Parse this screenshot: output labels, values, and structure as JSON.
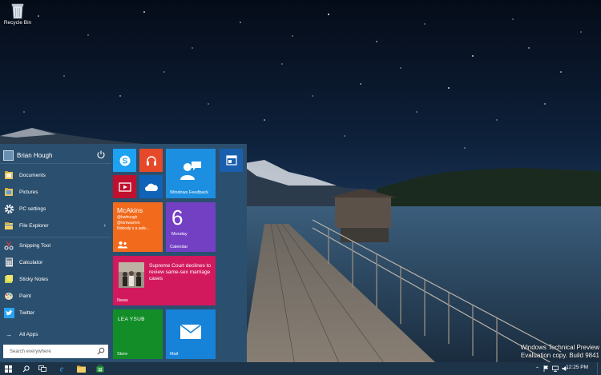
{
  "desktop": {
    "recycle_bin_label": "Recycle Bin"
  },
  "start_menu": {
    "user_name": "Brian Hough",
    "items": [
      {
        "label": "Documents",
        "icon": "documents-folder-icon"
      },
      {
        "label": "Pictures",
        "icon": "pictures-folder-icon"
      },
      {
        "label": "PC settings",
        "icon": "gear-icon"
      },
      {
        "label": "File Explorer",
        "icon": "file-explorer-icon",
        "has_submenu": true
      },
      {
        "label": "Snipping Tool",
        "icon": "scissors-icon"
      },
      {
        "label": "Calculator",
        "icon": "calculator-icon"
      },
      {
        "label": "Sticky Notes",
        "icon": "sticky-notes-icon"
      },
      {
        "label": "Paint",
        "icon": "paint-icon"
      },
      {
        "label": "Twitter",
        "icon": "twitter-bird-icon"
      }
    ],
    "all_apps_label": "All Apps",
    "search_placeholder": "Search everywhere"
  },
  "tiles": {
    "feedback_label": "Windows Feedback",
    "people_name": "McAkins",
    "people_handle": "@bwhough",
    "people_mention": "@tomwarren",
    "people_text": "Nobody s a safe...",
    "calendar_day": "6",
    "calendar_weekday": "Monday",
    "calendar_label": "Calendar",
    "news_headline": "Supreme Court declines to review same-sex marriage cases",
    "news_label": "News",
    "store_brand": "LEA YSUB",
    "store_label": "Store",
    "mail_label": "Mail"
  },
  "watermark": {
    "line1": "Windows Technical Preview",
    "line2": "Evaluation copy. Build 9841"
  },
  "taskbar": {
    "clock": "12:25 PM"
  },
  "colors": {
    "start_bg": "#2b4f6e",
    "tile_skype": "#1da1f2",
    "tile_music": "#e6492a",
    "tile_video": "#c0102d",
    "tile_onedrive": "#0f63b8",
    "tile_feedback": "#1d8fe0",
    "tile_people": "#f26b1d",
    "tile_calendar": "#7340c4",
    "tile_news": "#d3195d",
    "tile_store": "#138d28",
    "tile_mail": "#1682d8",
    "taskbar": "#1d3347"
  }
}
